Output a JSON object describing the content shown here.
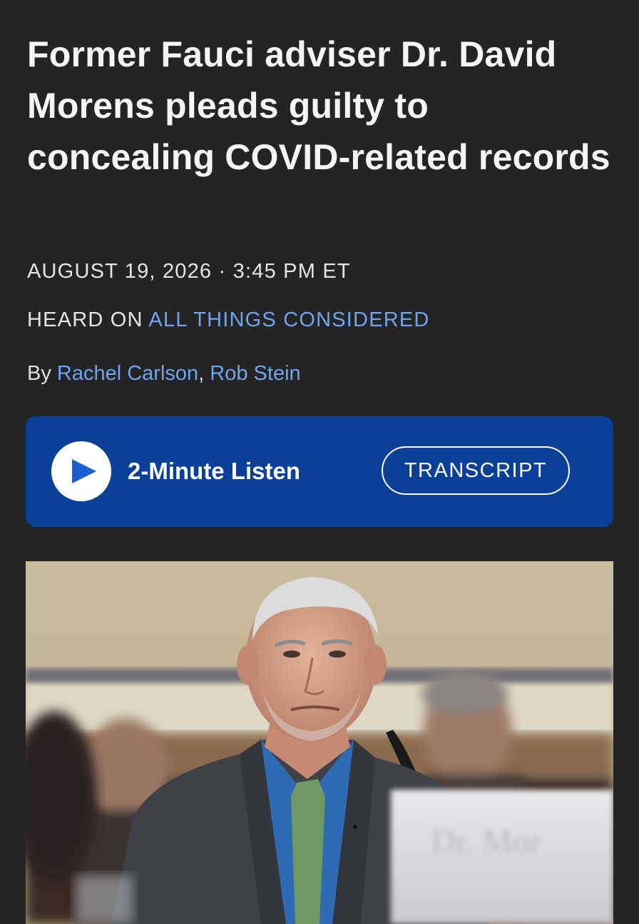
{
  "article": {
    "headline": "Former Fauci adviser Dr. David Morens pleads guilty to concealing COVID-related records",
    "date": "AUGUST 19, 2026",
    "separator": "·",
    "time": "3:45 PM ET",
    "heard_on_prefix": "HEARD ON",
    "program": "ALL THINGS CONSIDERED",
    "byline_prefix": "By",
    "authors": [
      "Rachel Carlson",
      "Rob Stein"
    ],
    "author_separator": ","
  },
  "audio": {
    "play_icon": "play-icon",
    "duration_label": "2-Minute Listen",
    "transcript_label": "TRANSCRIPT"
  },
  "photo": {
    "nameplate_text": "Dr. Mor"
  },
  "colors": {
    "background": "#242424",
    "link": "#6ea4f0",
    "listen_bar": "#0a3f9a",
    "play_arrow": "#1a5fd6"
  }
}
